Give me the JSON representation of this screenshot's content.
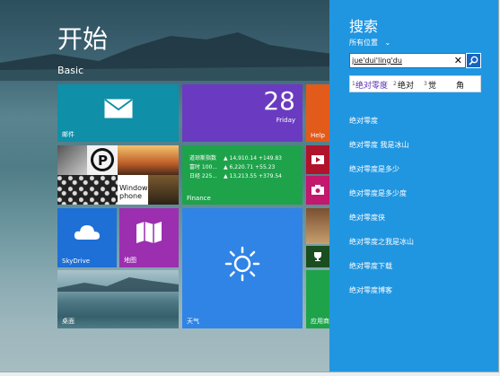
{
  "start": {
    "title": "开始",
    "user": "Basic"
  },
  "tiles": {
    "mail": {
      "label": "邮件",
      "icon": "mail-icon"
    },
    "calendar": {
      "day_number": "28",
      "weekday": "Friday",
      "label": "",
      "icon": "calendar-icon"
    },
    "help": {
      "label": "Help",
      "icon": "help-icon"
    },
    "photos": {
      "label": "",
      "windows_text": "Windows",
      "phone_text": "phone"
    },
    "finance": {
      "label": "Finance",
      "rows": [
        {
          "name": "道琼斯指数",
          "value": "▲ 14,910.14 +149.83"
        },
        {
          "name": "富时 100...",
          "value": "▲ 6,220.71 +55.23"
        },
        {
          "name": "日经 225...",
          "value": "▲ 13,213.55 +379.54"
        }
      ]
    },
    "skydrive": {
      "label": "SkyDrive",
      "icon": "cloud-icon"
    },
    "maps": {
      "label": "地图",
      "icon": "map-icon"
    },
    "weather": {
      "label": "天气",
      "icon": "sun-icon"
    },
    "desktop": {
      "label": "桌面"
    },
    "apps": {
      "label": "应用商"
    }
  },
  "search": {
    "title": "搜索",
    "scope": "所有位置",
    "query": "jue'dui'ling'du",
    "ime_candidates": [
      {
        "num": "1",
        "text": "绝对零度"
      },
      {
        "num": "2",
        "text": "绝对"
      },
      {
        "num": "3",
        "text": "觉"
      },
      {
        "num": "",
        "text": "角"
      }
    ],
    "suggestions": [
      "绝对零度",
      "绝对零度 我是冰山",
      "绝对零度是多少",
      "绝对零度是多少度",
      "绝对零度侠",
      "绝对零度之我是冰山",
      "绝对零度下载",
      "绝对零度博客"
    ]
  },
  "colors": {
    "pane": "#2196e0",
    "mail": "#0f8fa8",
    "calendar": "#6a3bc0",
    "help": "#e35b1a",
    "finance": "#1ea34b",
    "skydrive": "#1e6fd6",
    "maps": "#9b2fb0",
    "weather": "#2f84e6",
    "apps": "#1ea34b"
  }
}
